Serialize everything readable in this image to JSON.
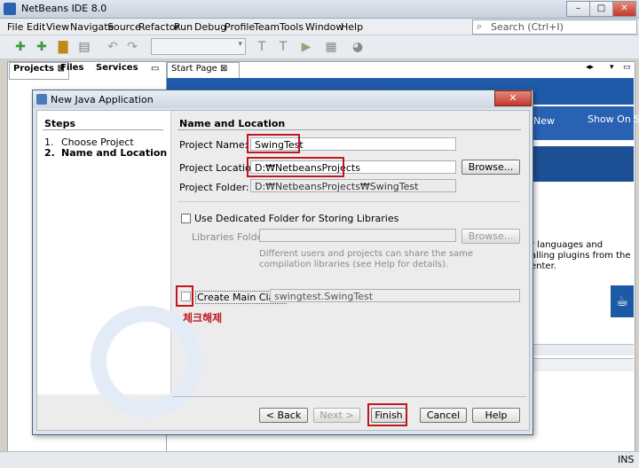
{
  "window": {
    "title": "NetBeans IDE 8.0",
    "min": "–",
    "max": "□",
    "close": "✕"
  },
  "menu": [
    "File",
    "Edit",
    "View",
    "Navigate",
    "Source",
    "Refactor",
    "Run",
    "Debug",
    "Profile",
    "Team",
    "Tools",
    "Window",
    "Help"
  ],
  "search": {
    "placeholder": "Search (Ctrl+I)"
  },
  "panel_tabs": {
    "projects": "Projects",
    "files": "Files",
    "services": "Services"
  },
  "editor_tab": "Start Page",
  "start_page": {
    "new": "New",
    "show_on": "Show On St",
    "text1": "r languages and",
    "text2": "alling plugins from the",
    "text3": "enter."
  },
  "status": {
    "ins": "INS"
  },
  "dialog": {
    "title": "New Java Application",
    "close": "✕",
    "steps_header": "Steps",
    "steps": [
      {
        "num": "1.",
        "label": "Choose Project"
      },
      {
        "num": "2.",
        "label": "Name and Location"
      }
    ],
    "section_title": "Name and Location",
    "project_name_label": "Project Name:",
    "project_name": "SwingTest",
    "project_location_label": "Project Location:",
    "project_location": "D:₩NetbeansProjects",
    "browse": "Browse...",
    "project_folder_label": "Project Folder:",
    "project_folder": "D:₩NetbeansProjects₩SwingTest",
    "dedicated_folder": "Use Dedicated Folder for Storing Libraries",
    "libraries_folder_label": "Libraries Folder:",
    "libraries_browse": "Browse...",
    "libraries_note1": "Different users and projects can share the same",
    "libraries_note2": "compilation libraries (see Help for details).",
    "create_main_label": "Create Main Class",
    "create_main_value": "swingtest.SwingTest",
    "annotation": "체크해제",
    "buttons": {
      "back": "< Back",
      "next": "Next >",
      "finish": "Finish",
      "cancel": "Cancel",
      "help": "Help"
    }
  },
  "colors": {
    "annotation": "#c0161e",
    "accent": "#1e5aa8"
  }
}
